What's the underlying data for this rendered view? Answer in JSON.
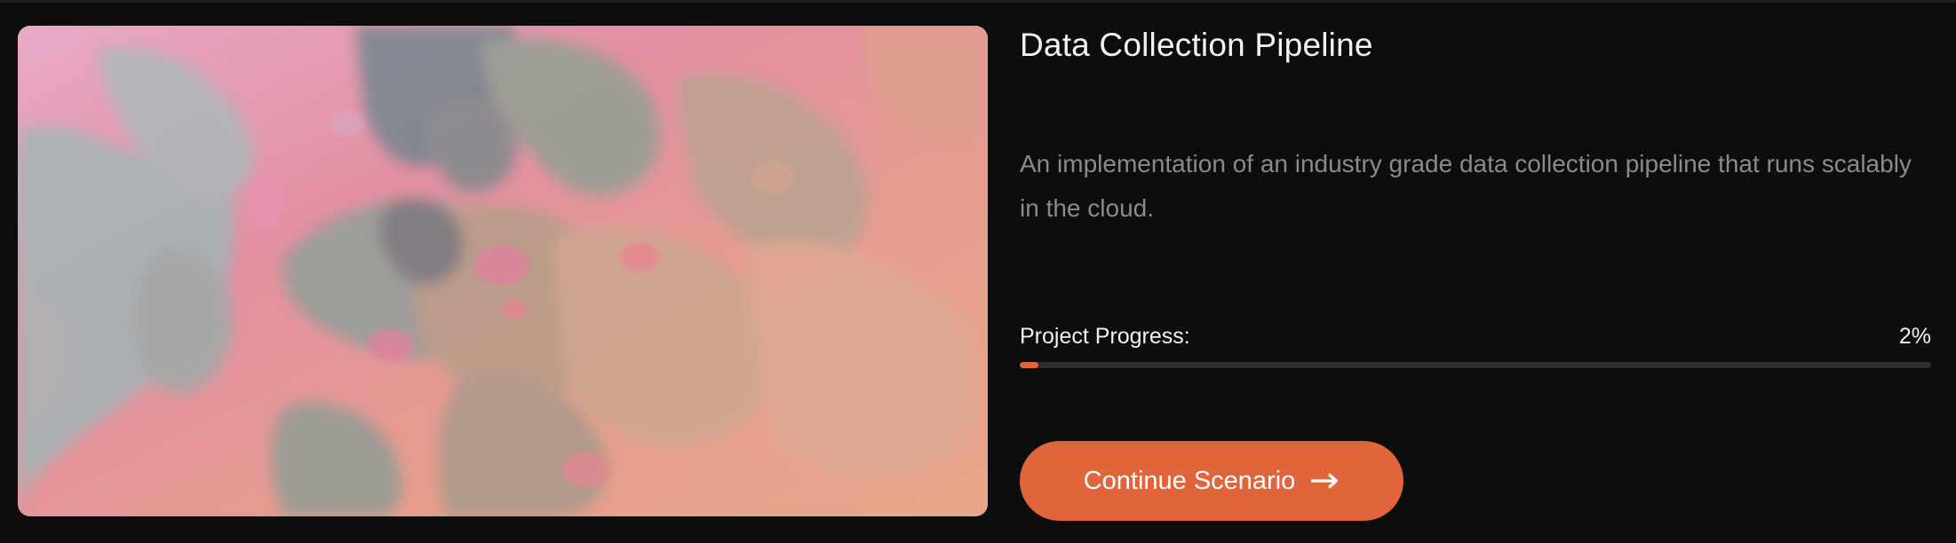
{
  "project": {
    "title": "Data Collection Pipeline",
    "description": "An implementation of an industry grade data collection pipeline that runs scalably in the cloud.",
    "progress_label": "Project Progress:",
    "progress_text": "2%",
    "progress_fraction": 0.02,
    "button_label": "Continue Scenario",
    "button_icon": "arrow-right-icon",
    "thumbnail": "abstract-fluid-art-image"
  },
  "colors": {
    "background": "#0d0d0d",
    "accent": "#e0653a",
    "track": "#2e2e2e",
    "title_text": "#f2f2f2",
    "muted_text": "#8a8a8a"
  }
}
